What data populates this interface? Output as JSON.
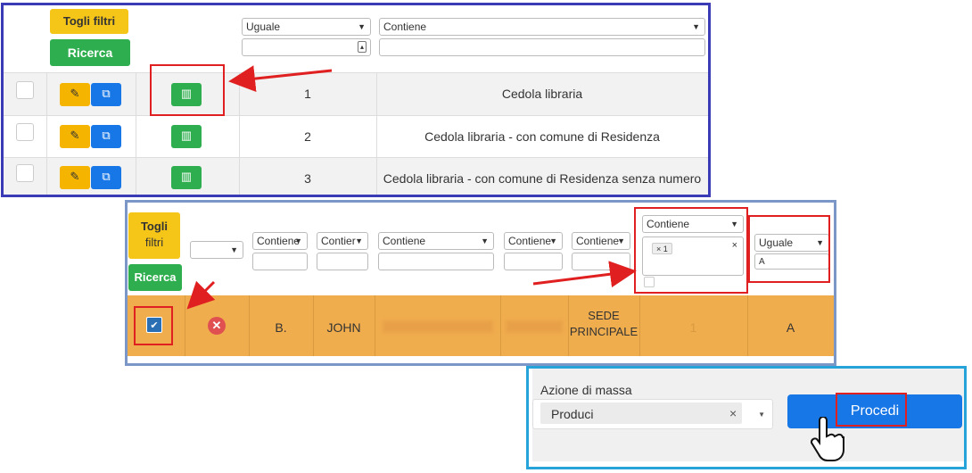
{
  "panel1": {
    "remove_filters": "Togli filtri",
    "search": "Ricerca",
    "filter_number_op": "Uguale",
    "filter_name_op": "Contiene",
    "rows": [
      {
        "num": "1",
        "name": "Cedola libraria"
      },
      {
        "num": "2",
        "name": "Cedola libraria - con comune di Residenza"
      },
      {
        "num": "3",
        "name": "Cedola libraria - con comune di Residenza senza numero"
      }
    ]
  },
  "panel2": {
    "remove_filters_1": "Togli",
    "remove_filters_2": "filtri",
    "search": "Ricerca",
    "filter_ops": [
      "Contiene",
      "Contier",
      "Contiene",
      "Contiene",
      "Contiene"
    ],
    "multi_filter_op": "Contiene",
    "multi_filter_tag": "× 1",
    "last_filter_op": "Uguale",
    "last_filter_value": "A",
    "row": {
      "col1": "B.",
      "col2": "JOHN",
      "col3": "SEDE",
      "col3b": "PRINCIPALE",
      "col4": "1",
      "col5": "A"
    }
  },
  "panel3": {
    "label": "Azione di massa",
    "selected_action": "Produci",
    "clear": "×",
    "proceed": "Procedi"
  },
  "colors": {
    "accent_blue": "#1877e6",
    "green": "#2eae4e",
    "yellow": "#f5c518",
    "orange_row": "#f0ad4e",
    "highlight_red": "#e02020"
  }
}
